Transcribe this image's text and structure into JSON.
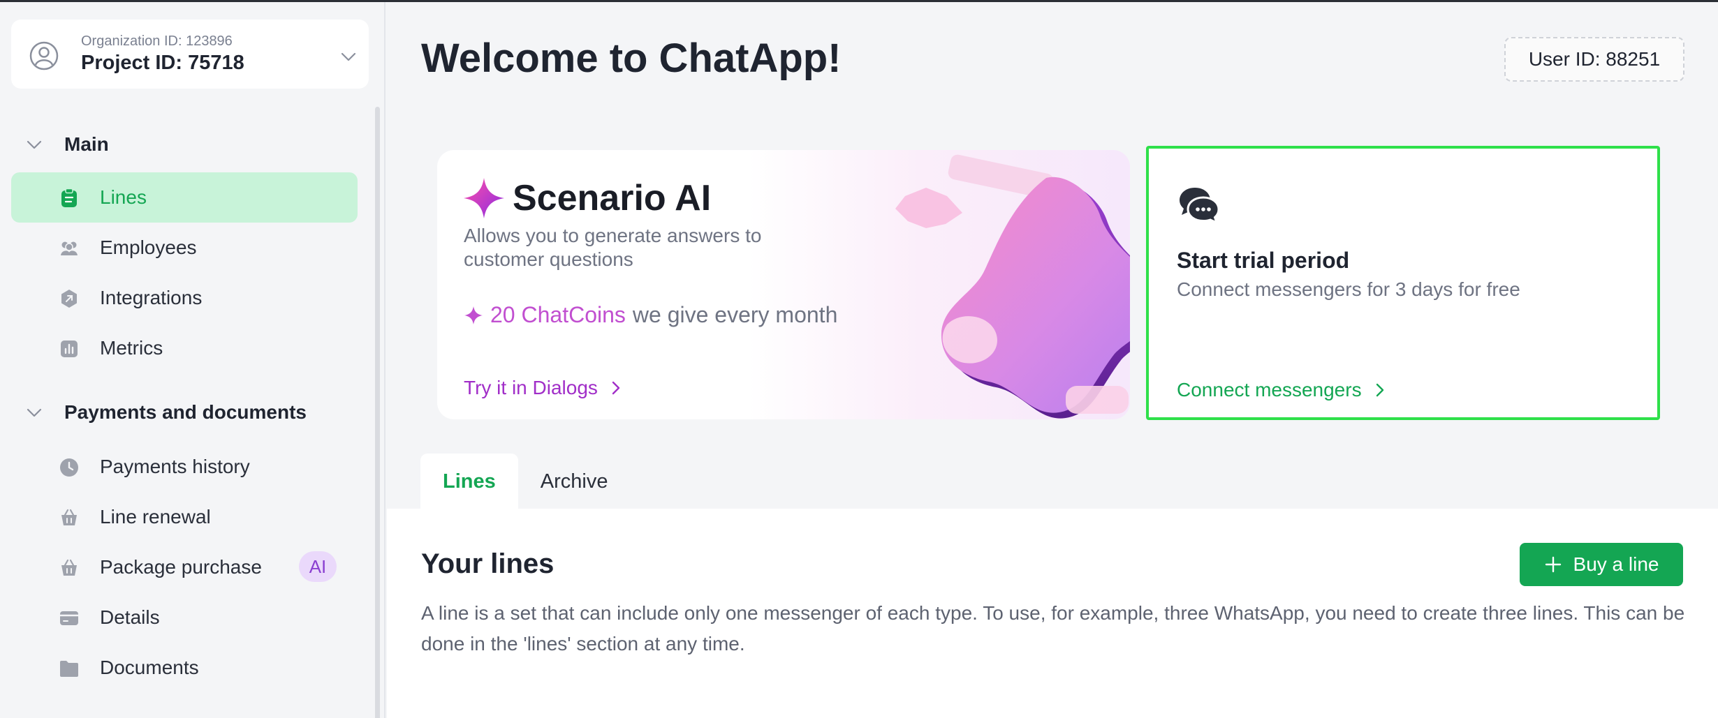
{
  "project": {
    "org_id": "Organization ID: 123896",
    "project_id": "Project ID: 75718"
  },
  "sidebar": {
    "sections": [
      {
        "title": "Main",
        "items": [
          {
            "label": "Lines",
            "icon": "clipboard-icon",
            "active": true
          },
          {
            "label": "Employees",
            "icon": "people-icon"
          },
          {
            "label": "Integrations",
            "icon": "puzzle-icon"
          },
          {
            "label": "Metrics",
            "icon": "bar-chart-icon"
          }
        ]
      },
      {
        "title": "Payments and documents",
        "items": [
          {
            "label": "Payments history",
            "icon": "clock-icon"
          },
          {
            "label": "Line renewal",
            "icon": "basket-icon"
          },
          {
            "label": "Package purchase",
            "icon": "basket-icon",
            "badge": "AI"
          },
          {
            "label": "Details",
            "icon": "card-icon"
          },
          {
            "label": "Documents",
            "icon": "folder-icon"
          }
        ]
      }
    ]
  },
  "header": {
    "title": "Welcome to ChatApp!",
    "user_id": "User ID: 88251"
  },
  "promo": {
    "title": "Scenario AI",
    "description": "Allows you to generate answers to customer questions",
    "coins_amount": "20 ChatCoins",
    "coins_rest": "we give every month",
    "link": "Try it in Dialogs"
  },
  "trial": {
    "title": "Start trial period",
    "description": "Connect messengers for 3 days for free",
    "link": "Connect messengers"
  },
  "tabs": [
    {
      "label": "Lines",
      "active": true
    },
    {
      "label": "Archive"
    }
  ],
  "lines": {
    "title": "Your lines",
    "buy_button": "Buy a line",
    "description": "A line is a set that can include only one messenger of each type. To use, for example, three WhatsApp, you need to create three lines. This can be done in the 'lines' section at any time."
  },
  "colors": {
    "accent_green": "#14a653",
    "active_bg": "#c8f3d9",
    "promo_purple": "#a12ec8",
    "highlight_border": "#2fe04a"
  }
}
